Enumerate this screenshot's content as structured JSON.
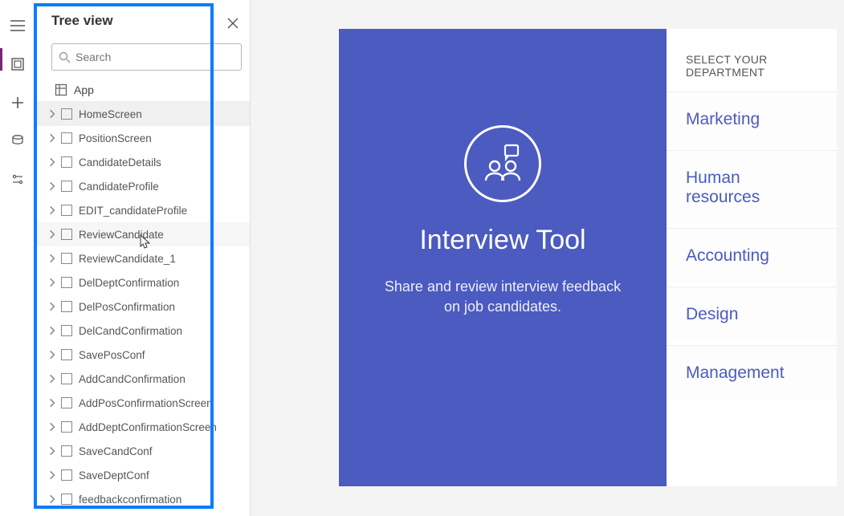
{
  "panel": {
    "title": "Tree view",
    "search_placeholder": "Search",
    "app_label": "App"
  },
  "tree": {
    "items": [
      {
        "label": "HomeScreen",
        "selected": true,
        "dots": true
      },
      {
        "label": "PositionScreen"
      },
      {
        "label": "CandidateDetails"
      },
      {
        "label": "CandidateProfile"
      },
      {
        "label": "EDIT_candidateProfile"
      },
      {
        "label": "ReviewCandidate",
        "hover": true,
        "dots": true,
        "cursor": true
      },
      {
        "label": "ReviewCandidate_1"
      },
      {
        "label": "DelDeptConfirmation"
      },
      {
        "label": "DelPosConfirmation"
      },
      {
        "label": "DelCandConfirmation"
      },
      {
        "label": "SavePosConf"
      },
      {
        "label": "AddCandConfirmation"
      },
      {
        "label": "AddPosConfirmationScreen"
      },
      {
        "label": "AddDeptConfirmationScreen"
      },
      {
        "label": "SaveCandConf"
      },
      {
        "label": "SaveDeptConf"
      },
      {
        "label": "feedbackconfirmation"
      }
    ]
  },
  "preview": {
    "title": "Interview Tool",
    "subtitle": "Share and review interview feedback on job candidates.",
    "dept_header": "SELECT YOUR DEPARTMENT",
    "departments": [
      "Marketing",
      "Human resources",
      "Accounting",
      "Design",
      "Management"
    ]
  }
}
